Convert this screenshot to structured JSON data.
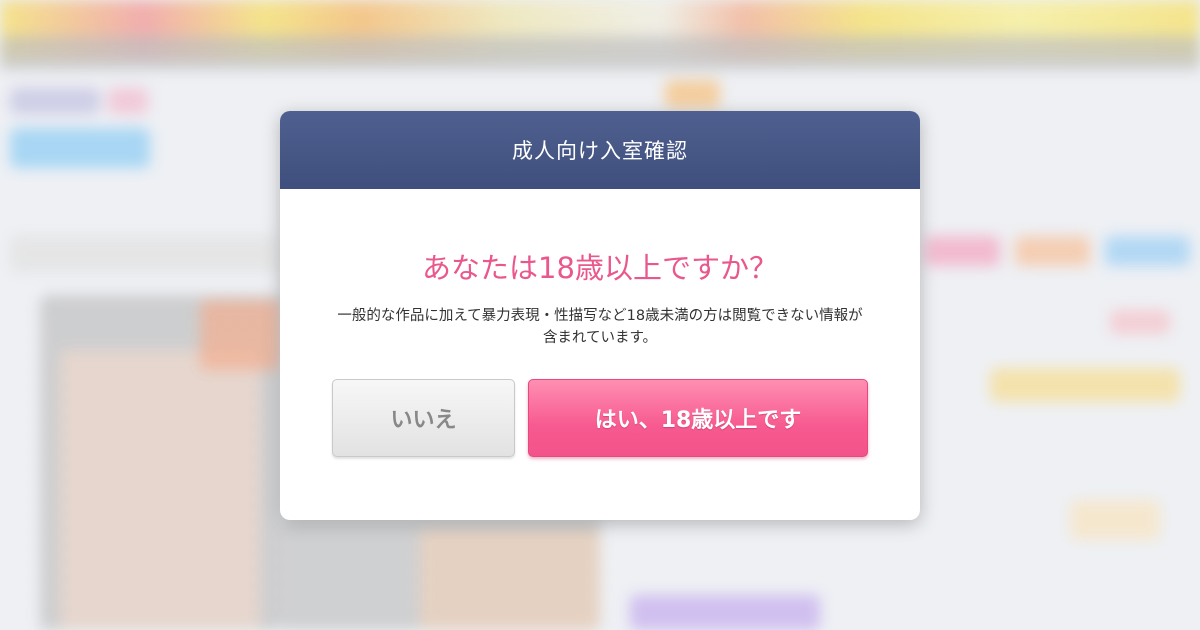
{
  "dialog": {
    "title": "成人向け入室確認",
    "question": "あなたは18歳以上ですか？",
    "description": "一般的な作品に加えて暴力表現・性描写など18歳未満の方は閲覧できない情報が含まれています。",
    "no_label": "いいえ",
    "yes_label": "はい、18歳以上です"
  },
  "colors": {
    "header_bg": "#46567f",
    "question_text": "#e9578c",
    "yes_button": "#f75a90",
    "no_button": "#e8e8e8"
  }
}
